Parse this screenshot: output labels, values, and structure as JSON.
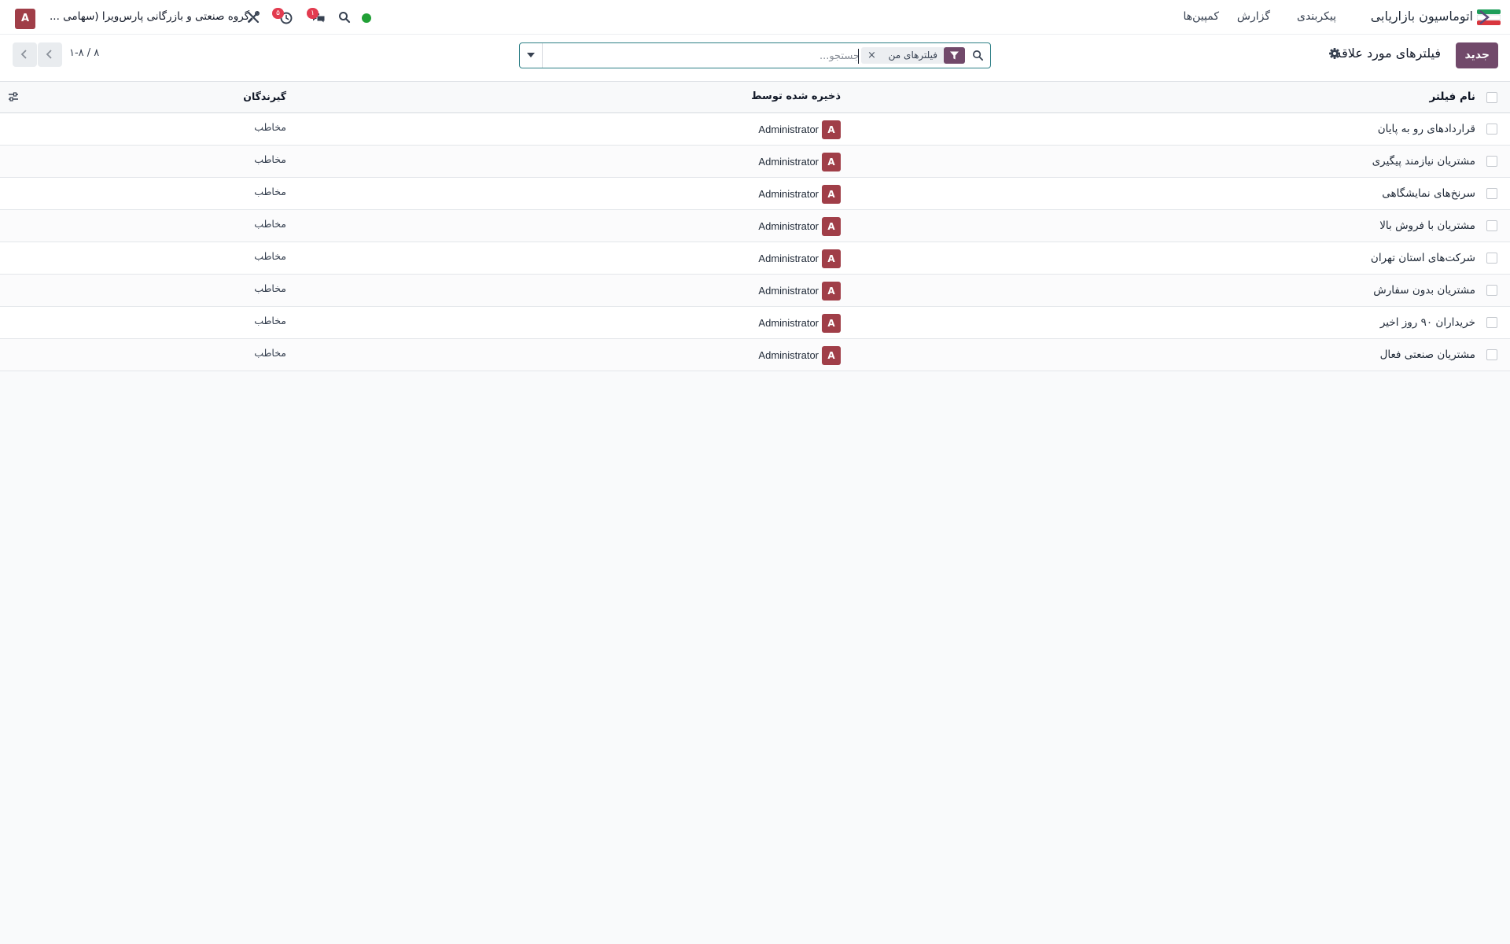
{
  "navbar": {
    "app_title": "اتوماسیون بازاریابی",
    "menu": [
      "کمپین‌ها",
      "گزارش",
      "پیکربندی"
    ],
    "company_name": "گروه صنعتی و بازرگانی پارس‌ویرا (سهامی ...",
    "user_initial": "A",
    "activity_count": "۵",
    "chat_count": "۱",
    "status_color": "#21a036"
  },
  "control_panel": {
    "new_label": "جدید",
    "title": "فیلترهای مورد علاقه",
    "search": {
      "facet_label": "فیلترهای من",
      "facet_remove": "×",
      "placeholder": "جستجو...",
      "value": ""
    },
    "pager": "۱-۸ / ۸"
  },
  "table": {
    "columns": {
      "name": "نام فیلتر",
      "saved_by": "ذخیره شده توسط",
      "recipients": "گیرندگان"
    },
    "rows": [
      {
        "name": "قراردادهای رو به پایان",
        "user_initial": "A",
        "user": "Administrator",
        "recipient": "مخاطب"
      },
      {
        "name": "مشتریان نیازمند پیگیری",
        "user_initial": "A",
        "user": "Administrator",
        "recipient": "مخاطب"
      },
      {
        "name": "سرنخ‌های نمایشگاهی",
        "user_initial": "A",
        "user": "Administrator",
        "recipient": "مخاطب"
      },
      {
        "name": "مشتریان با فروش بالا",
        "user_initial": "A",
        "user": "Administrator",
        "recipient": "مخاطب"
      },
      {
        "name": "شرکت‌های استان تهران",
        "user_initial": "A",
        "user": "Administrator",
        "recipient": "مخاطب"
      },
      {
        "name": "مشتریان بدون سفارش",
        "user_initial": "A",
        "user": "Administrator",
        "recipient": "مخاطب"
      },
      {
        "name": "خریداران ۹۰ روز اخیر",
        "user_initial": "A",
        "user": "Administrator",
        "recipient": "مخاطب"
      },
      {
        "name": "مشتریان صنعتی فعال",
        "user_initial": "A",
        "user": "Administrator",
        "recipient": "مخاطب"
      }
    ]
  },
  "colors": {
    "brand": "#71496a",
    "avatar": "#a03e48",
    "badge": "#e23b4f",
    "search_border": "#2d7f86"
  }
}
